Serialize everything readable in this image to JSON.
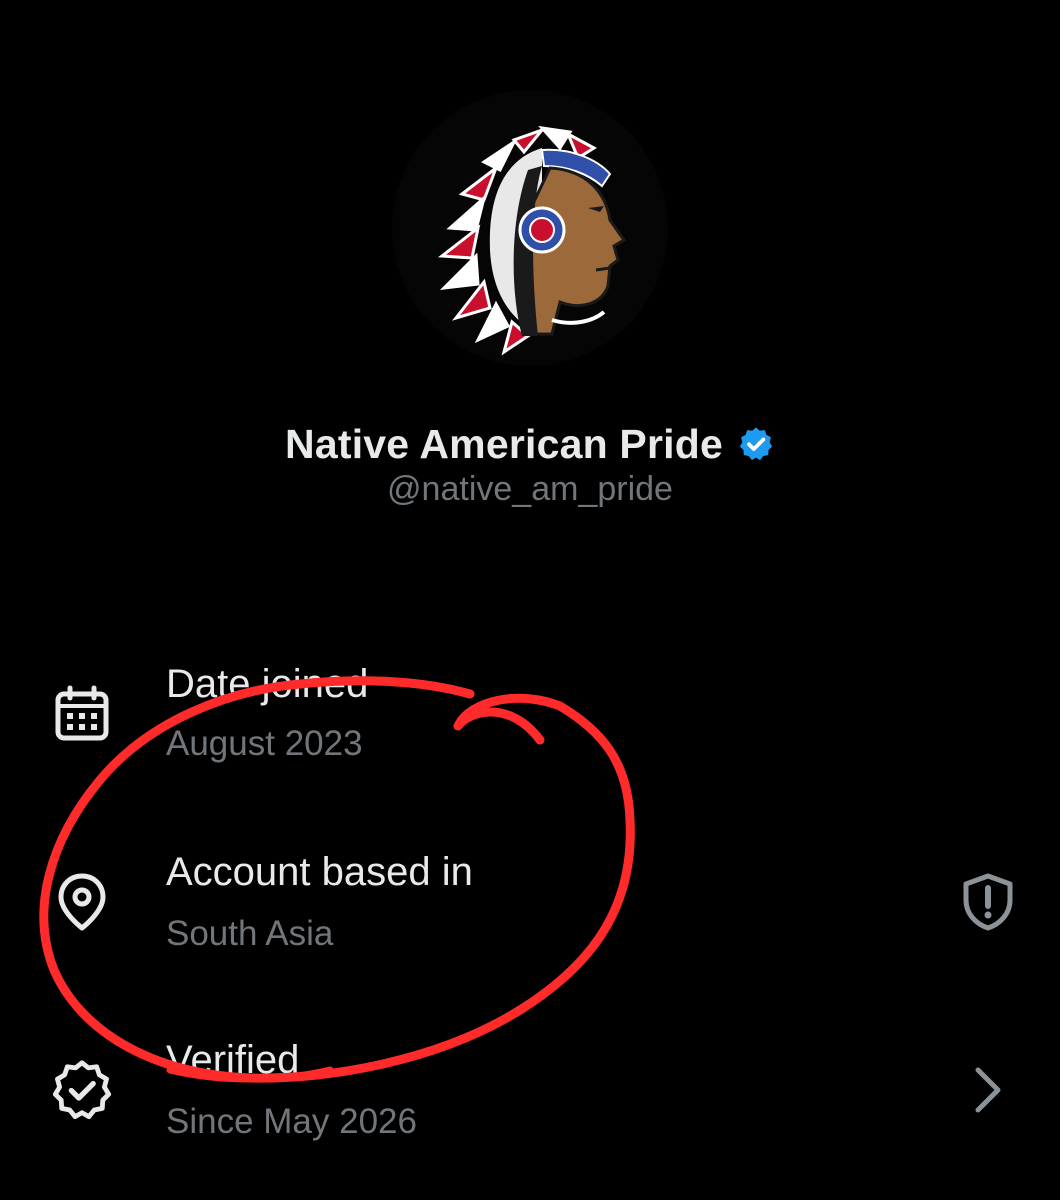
{
  "profile": {
    "display_name": "Native American Pride",
    "handle": "@native_am_pride",
    "avatar_icon": "native-chief-headdress-logo",
    "verified_icon": "verified-badge-icon"
  },
  "about_rows": [
    {
      "icon": "calendar-icon",
      "label": "Date joined",
      "value": "August 2023"
    },
    {
      "icon": "location-pin-icon",
      "label": "Account based in",
      "value": "South Asia",
      "trailing_icon": "shield-alert-icon"
    },
    {
      "icon": "verified-check-icon",
      "label": "Verified",
      "value": "Since May 2026",
      "trailing_icon": "chevron-right-icon"
    }
  ],
  "colors": {
    "background": "#000000",
    "primary_text": "#e7e9ea",
    "secondary_text": "#71767b",
    "verified_blue": "#1d9bf0",
    "annotation_red": "#ff2b2b"
  }
}
